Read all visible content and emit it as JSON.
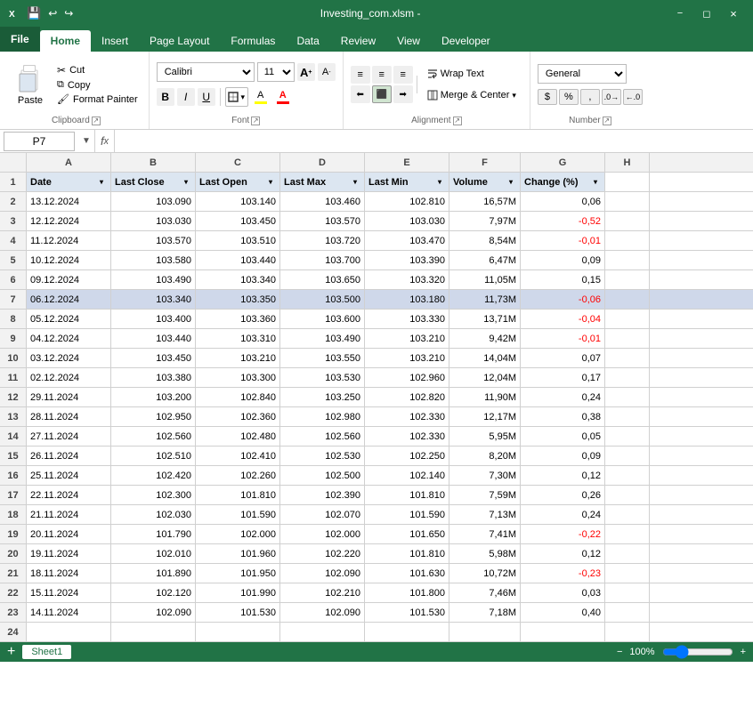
{
  "titleBar": {
    "filename": "Investing_com.xlsm -",
    "appName": "Microsoft Excel"
  },
  "ribbonTabs": {
    "tabs": [
      "File",
      "Home",
      "Insert",
      "Page Layout",
      "Formulas",
      "Data",
      "Review",
      "View",
      "Developer"
    ],
    "activeTab": "Home"
  },
  "clipboard": {
    "groupLabel": "Clipboard",
    "pasteLabel": "Paste",
    "cutLabel": "Cut",
    "copyLabel": "Copy",
    "formatPainterLabel": "Format Painter"
  },
  "font": {
    "groupLabel": "Font",
    "fontName": "Calibri",
    "fontSize": "11",
    "boldLabel": "B",
    "italicLabel": "I",
    "underlineLabel": "U",
    "increaseSizeLabel": "A",
    "decreaseSizeLabel": "A"
  },
  "alignment": {
    "groupLabel": "Alignment",
    "wrapTextLabel": "Wrap Text",
    "mergeCenterLabel": "Merge & Center"
  },
  "number": {
    "groupLabel": "Number",
    "format": "General"
  },
  "formulaBar": {
    "cellRef": "P7",
    "formula": ""
  },
  "columns": {
    "letters": [
      "",
      "A",
      "B",
      "C",
      "D",
      "E",
      "F",
      "G",
      "H"
    ],
    "headers": [
      "Date",
      "Last Close",
      "Last Open",
      "Last Max",
      "Last Min",
      "Volume",
      "Change (%)"
    ]
  },
  "rows": [
    {
      "num": 1,
      "isHeader": true,
      "cells": [
        "Date",
        "Last Close",
        "Last Open",
        "Last Max",
        "Last Min",
        "Volume",
        "Change (%)"
      ]
    },
    {
      "num": 2,
      "cells": [
        "13.12.2024",
        "103.090",
        "103.140",
        "103.460",
        "102.810",
        "16,57M",
        "0,06"
      ]
    },
    {
      "num": 3,
      "cells": [
        "12.12.2024",
        "103.030",
        "103.450",
        "103.570",
        "103.030",
        "7,97M",
        "-0,52"
      ]
    },
    {
      "num": 4,
      "cells": [
        "11.12.2024",
        "103.570",
        "103.510",
        "103.720",
        "103.470",
        "8,54M",
        "-0,01"
      ]
    },
    {
      "num": 5,
      "cells": [
        "10.12.2024",
        "103.580",
        "103.440",
        "103.700",
        "103.390",
        "6,47M",
        "0,09"
      ]
    },
    {
      "num": 6,
      "cells": [
        "09.12.2024",
        "103.490",
        "103.340",
        "103.650",
        "103.320",
        "11,05M",
        "0,15"
      ]
    },
    {
      "num": 7,
      "cells": [
        "06.12.2024",
        "103.340",
        "103.350",
        "103.500",
        "103.180",
        "11,73M",
        "-0,06"
      ],
      "highlighted": true
    },
    {
      "num": 8,
      "cells": [
        "05.12.2024",
        "103.400",
        "103.360",
        "103.600",
        "103.330",
        "13,71M",
        "-0,04"
      ]
    },
    {
      "num": 9,
      "cells": [
        "04.12.2024",
        "103.440",
        "103.310",
        "103.490",
        "103.210",
        "9,42M",
        "-0,01"
      ]
    },
    {
      "num": 10,
      "cells": [
        "03.12.2024",
        "103.450",
        "103.210",
        "103.550",
        "103.210",
        "14,04M",
        "0,07"
      ]
    },
    {
      "num": 11,
      "cells": [
        "02.12.2024",
        "103.380",
        "103.300",
        "103.530",
        "102.960",
        "12,04M",
        "0,17"
      ]
    },
    {
      "num": 12,
      "cells": [
        "29.11.2024",
        "103.200",
        "102.840",
        "103.250",
        "102.820",
        "11,90M",
        "0,24"
      ]
    },
    {
      "num": 13,
      "cells": [
        "28.11.2024",
        "102.950",
        "102.360",
        "102.980",
        "102.330",
        "12,17M",
        "0,38"
      ]
    },
    {
      "num": 14,
      "cells": [
        "27.11.2024",
        "102.560",
        "102.480",
        "102.560",
        "102.330",
        "5,95M",
        "0,05"
      ]
    },
    {
      "num": 15,
      "cells": [
        "26.11.2024",
        "102.510",
        "102.410",
        "102.530",
        "102.250",
        "8,20M",
        "0,09"
      ]
    },
    {
      "num": 16,
      "cells": [
        "25.11.2024",
        "102.420",
        "102.260",
        "102.500",
        "102.140",
        "7,30M",
        "0,12"
      ]
    },
    {
      "num": 17,
      "cells": [
        "22.11.2024",
        "102.300",
        "101.810",
        "102.390",
        "101.810",
        "7,59M",
        "0,26"
      ]
    },
    {
      "num": 18,
      "cells": [
        "21.11.2024",
        "102.030",
        "101.590",
        "102.070",
        "101.590",
        "7,13M",
        "0,24"
      ]
    },
    {
      "num": 19,
      "cells": [
        "20.11.2024",
        "101.790",
        "102.000",
        "102.000",
        "101.650",
        "7,41M",
        "-0,22"
      ]
    },
    {
      "num": 20,
      "cells": [
        "19.11.2024",
        "102.010",
        "101.960",
        "102.220",
        "101.810",
        "5,98M",
        "0,12"
      ]
    },
    {
      "num": 21,
      "cells": [
        "18.11.2024",
        "101.890",
        "101.950",
        "102.090",
        "101.630",
        "10,72M",
        "-0,23"
      ]
    },
    {
      "num": 22,
      "cells": [
        "15.11.2024",
        "102.120",
        "101.990",
        "102.210",
        "101.800",
        "7,46M",
        "0,03"
      ]
    },
    {
      "num": 23,
      "cells": [
        "14.11.2024",
        "102.090",
        "101.530",
        "102.090",
        "101.530",
        "7,18M",
        "0,40"
      ]
    },
    {
      "num": 24,
      "cells": [
        "",
        "",
        "",
        "",
        "",
        "",
        ""
      ]
    }
  ],
  "statusBar": {
    "sheetTabs": [
      "Sheet1"
    ],
    "zoomLabel": "100%"
  }
}
